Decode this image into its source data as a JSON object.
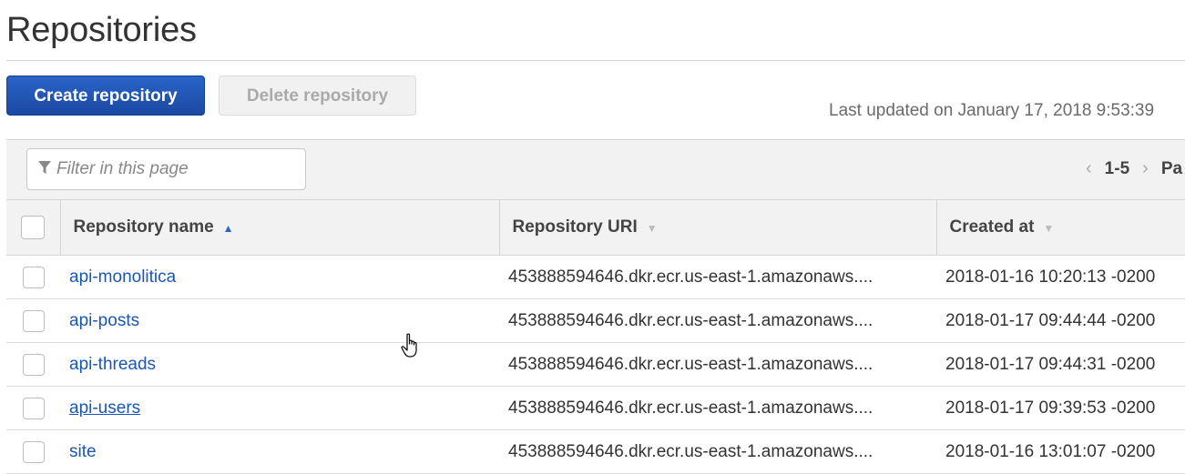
{
  "page": {
    "title": "Repositories"
  },
  "toolbar": {
    "create_label": "Create repository",
    "delete_label": "Delete repository",
    "last_updated": "Last updated on January 17, 2018 9:53:39"
  },
  "filter": {
    "placeholder": "Filter in this page",
    "icon": "filter-icon"
  },
  "pager": {
    "prev": "‹",
    "range": "1-5",
    "next": "›",
    "page_label": "Pa"
  },
  "table": {
    "columns": [
      {
        "label": "Repository name",
        "sort": "ascending"
      },
      {
        "label": "Repository URI",
        "sort": "none"
      },
      {
        "label": "Created at",
        "sort": "none"
      }
    ],
    "rows": [
      {
        "name": "api-monolitica",
        "uri": "453888594646.dkr.ecr.us-east-1.amazonaws....",
        "created": "2018-01-16 10:20:13 -0200"
      },
      {
        "name": "api-posts",
        "uri": "453888594646.dkr.ecr.us-east-1.amazonaws....",
        "created": "2018-01-17 09:44:44 -0200"
      },
      {
        "name": "api-threads",
        "uri": "453888594646.dkr.ecr.us-east-1.amazonaws....",
        "created": "2018-01-17 09:44:31 -0200"
      },
      {
        "name": "api-users",
        "uri": "453888594646.dkr.ecr.us-east-1.amazonaws....",
        "created": "2018-01-17 09:39:53 -0200"
      },
      {
        "name": "site",
        "uri": "453888594646.dkr.ecr.us-east-1.amazonaws....",
        "created": "2018-01-16 13:01:07 -0200"
      }
    ]
  },
  "colors": {
    "primary": "#1a49a3",
    "link": "#1a56b8",
    "panel": "#f2f2f2"
  }
}
